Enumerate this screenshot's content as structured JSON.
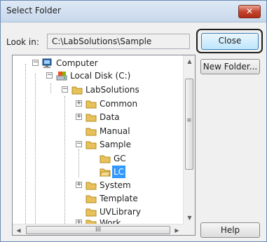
{
  "window": {
    "title": "Select Folder",
    "close_glyph": "✕"
  },
  "lookin": {
    "label": "Look in:",
    "value": "C:\\LabSolutions\\Sample"
  },
  "buttons": {
    "close": "Close",
    "new_folder": "New Folder...",
    "help": "Help"
  },
  "tree": {
    "items": [
      {
        "label": "Computer",
        "icon": "computer-icon",
        "expander": "−"
      },
      {
        "label": "Local Disk (C:)",
        "icon": "drive-icon",
        "expander": "−"
      },
      {
        "label": "LabSolutions",
        "icon": "folder-icon",
        "expander": "−"
      },
      {
        "label": "Common",
        "icon": "folder-icon",
        "expander": "+"
      },
      {
        "label": "Data",
        "icon": "folder-icon",
        "expander": "+"
      },
      {
        "label": "Manual",
        "icon": "folder-icon",
        "expander": ""
      },
      {
        "label": "Sample",
        "icon": "folder-icon",
        "expander": "−"
      },
      {
        "label": "GC",
        "icon": "folder-icon",
        "expander": ""
      },
      {
        "label": "LC",
        "icon": "folder-icon",
        "expander": "",
        "selected": true
      },
      {
        "label": "System",
        "icon": "folder-icon",
        "expander": "+"
      },
      {
        "label": "Template",
        "icon": "folder-icon",
        "expander": ""
      },
      {
        "label": "UVLibrary",
        "icon": "folder-icon",
        "expander": ""
      },
      {
        "label": "Work",
        "icon": "folder-icon",
        "expander": "+"
      }
    ],
    "scroll": {
      "up": "▲",
      "down": "▼",
      "left": "◀",
      "right": "▶",
      "grip_h": "III",
      "grip_v": "≡"
    }
  },
  "colors": {
    "selection": "#3399ff",
    "folder": "#e8c15a",
    "title_close": "#c3452f"
  }
}
